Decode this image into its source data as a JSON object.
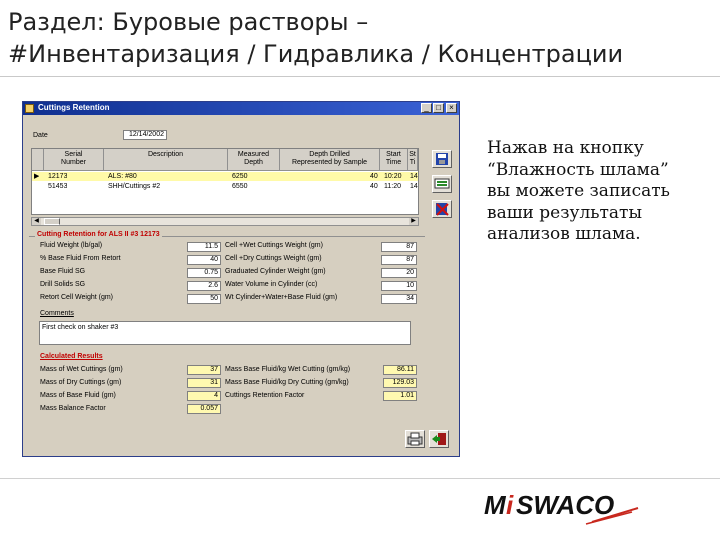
{
  "slide": {
    "title_line1": "Раздел: Буровые растворы –",
    "title_line2": "#Инвентаризация / Гидравлика / Концентрации",
    "caption": "Нажав на кнопку\n“Влажность шлама”\nвы можете записать\nваши  результаты\nанализов шлама.",
    "logo_text": "MiSWACO",
    "logo_colors": {
      "text": "#111111",
      "accent": "#c8281e"
    }
  },
  "window": {
    "title": "Cuttings Retention",
    "controls": [
      "_",
      "□",
      "×"
    ],
    "date_label": "Date",
    "date_value": "12/14/2002",
    "grid": {
      "columns": [
        "Serial\nNumber",
        "Description",
        "Measured\nDepth",
        "Depth Drilled\nRepresented by Sample",
        "Start\nTime",
        "St\nTi"
      ],
      "rows": [
        {
          "marker": "▶",
          "serial": "12173",
          "description": "ALS: #80",
          "depth": "6250",
          "drilled": "40",
          "time": "10:20",
          "st": "14"
        },
        {
          "marker": "",
          "serial": "51453",
          "description": "SHH/Cuttings #2",
          "depth": "6550",
          "drilled": "40",
          "time": "11:20",
          "st": "14"
        }
      ]
    },
    "section1_title": "Cutting Retention for ALS II  #3 12173",
    "left_fields": [
      {
        "label": "Fluid Weight (lb/gal)",
        "value": "11.5"
      },
      {
        "label": "% Base Fluid From Retort",
        "value": "40"
      },
      {
        "label": "Base Fluid SG",
        "value": "0.75"
      },
      {
        "label": "Drill Solids SG",
        "value": "2.6"
      },
      {
        "label": "Retort Cell Weight (gm)",
        "value": "50"
      }
    ],
    "right_fields": [
      {
        "label": "Cell +Wet Cuttings Weight (gm)",
        "value": "87"
      },
      {
        "label": "Cell +Dry Cuttings Weight (gm)",
        "value": "87"
      },
      {
        "label": "Graduated Cylinder Weight (gm)",
        "value": "20"
      },
      {
        "label": "Water Volume in Cylinder (cc)",
        "value": "10"
      },
      {
        "label": "Wt Cylinder+Water+Base Fluid (gm)",
        "value": "34"
      }
    ],
    "comments_label": "Comments",
    "comments_value": "First check on shaker #3",
    "results_title": "Calculated Results",
    "results_left": [
      {
        "label": "Mass of Wet Cuttings (gm)",
        "value": "37"
      },
      {
        "label": "Mass of Dry Cuttings (gm)",
        "value": "31"
      },
      {
        "label": "Mass of Base Fluid (gm)",
        "value": "4"
      },
      {
        "label": "Mass Balance Factor",
        "value": "0.057"
      }
    ],
    "results_right": [
      {
        "label": "Mass Base Fluid/kg Wet Cutting (gm/kg)",
        "value": "86.11"
      },
      {
        "label": "Mass Base Fluid/kg Dry Cutting (gm/kg)",
        "value": "129.03"
      },
      {
        "label": "Cuttings Retention Factor",
        "value": "1.01"
      }
    ],
    "icons": [
      "save-icon",
      "print-preview-icon",
      "delete-record-icon",
      "print-icon",
      "exit-door-icon"
    ],
    "colors": {
      "titlebar": "#1a3fa8",
      "panel": "#d6cfc0",
      "selected_row": "#fffaa8",
      "results_field": "#fff9b0",
      "section_title": "#c00000"
    }
  }
}
